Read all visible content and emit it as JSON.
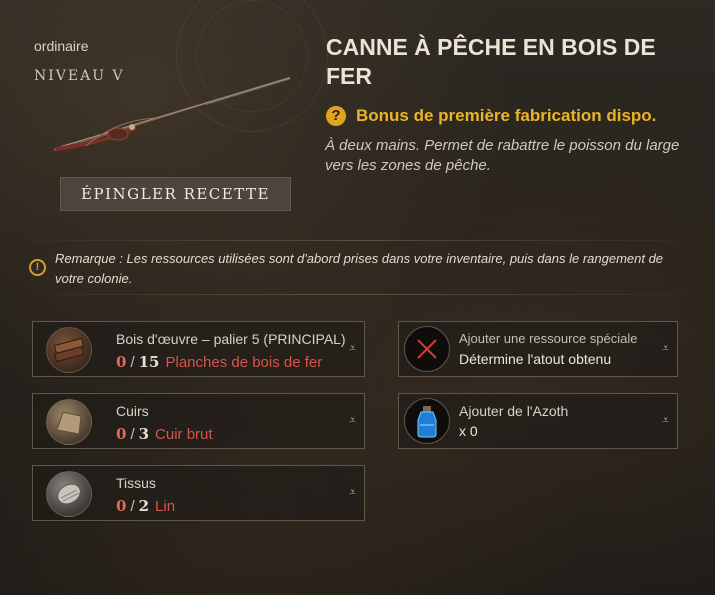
{
  "recipe": {
    "rarity": "ordinaire",
    "level": "NIVEAU V",
    "pin_button": "ÉPINGLER RECETTE",
    "title": "CANNE À PÊCHE EN BOIS DE FER",
    "bonus_text": "Bonus de première fabrication dispo.",
    "description": "À deux mains. Permet de rabattre le poisson du large vers les zones de pêche.",
    "note": "Remarque : Les ressources utilisées sont d'abord prises dans votre inventaire, puis dans le rangement de votre colonie."
  },
  "ingredients": [
    {
      "name": "Bois d'œuvre – palier 5 (PRINCIPAL)",
      "have": "0",
      "need": "15",
      "resource": "Planches de bois de fer",
      "icon": "planks-icon"
    },
    {
      "name": "Cuirs",
      "have": "0",
      "need": "3",
      "resource": "Cuir brut",
      "icon": "leather-icon"
    },
    {
      "name": "Tissus",
      "have": "0",
      "need": "2",
      "resource": "Lin",
      "icon": "linen-icon"
    }
  ],
  "special": {
    "title": "Ajouter une ressource spéciale",
    "subtitle": "Détermine l'atout obtenu",
    "icon": "empty-slot-x-icon"
  },
  "azoth": {
    "title": "Ajouter de l'Azoth",
    "count": "x 0",
    "icon": "azoth-vial-icon"
  },
  "colors": {
    "accent_gold": "#e9b425",
    "missing_red": "#d9544a"
  }
}
